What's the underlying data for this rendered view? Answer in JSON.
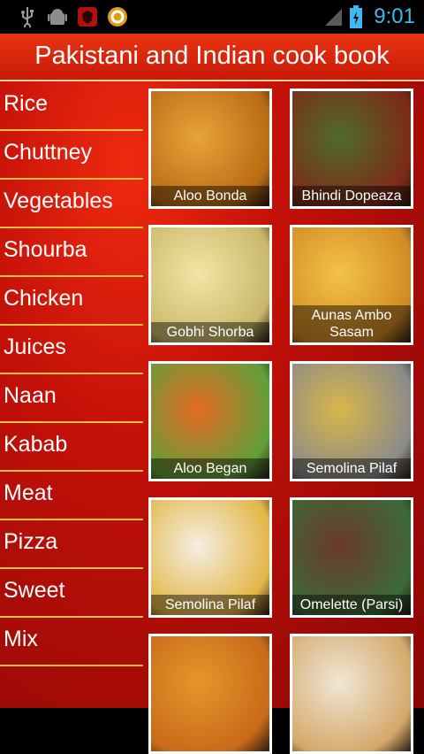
{
  "status_bar": {
    "icons": [
      "usb-icon",
      "android-debug-icon",
      "shield-icon",
      "sync-icon"
    ],
    "time": "9:01"
  },
  "header": {
    "title": "Pakistani and Indian cook book"
  },
  "sidebar": {
    "items": [
      {
        "label": "Rice"
      },
      {
        "label": "Chuttney"
      },
      {
        "label": "Vegetables"
      },
      {
        "label": "Shourba"
      },
      {
        "label": "Chicken"
      },
      {
        "label": "Juices"
      },
      {
        "label": "Naan"
      },
      {
        "label": "Kabab"
      },
      {
        "label": "Meat"
      },
      {
        "label": "Pizza"
      },
      {
        "label": "Sweet"
      },
      {
        "label": "Mix"
      }
    ]
  },
  "recipes": [
    {
      "title": "Aloo Bonda",
      "color1": "#e8a33a",
      "color2": "#b86a14"
    },
    {
      "title": "Bhindi Dopeaza",
      "color1": "#4f6b2a",
      "color2": "#7e2a18"
    },
    {
      "title": "Gobhi Shorba",
      "color1": "#f2e6a6",
      "color2": "#c9b86a"
    },
    {
      "title": "Aunas Ambo Sasam",
      "color1": "#f3c248",
      "color2": "#d18a24"
    },
    {
      "title": "Aloo Began",
      "color1": "#e46a22",
      "color2": "#5fa03a"
    },
    {
      "title": "Semolina Pilaf",
      "color1": "#d9b64a",
      "color2": "#8a8a8a"
    },
    {
      "title": "Semolina Pilaf",
      "color1": "#f4efe2",
      "color2": "#e3b545"
    },
    {
      "title": "Omelette (Parsi)",
      "color1": "#6a3a2a",
      "color2": "#3c6a3a"
    },
    {
      "title": "",
      "color1": "#e6962a",
      "color2": "#c86a1a"
    },
    {
      "title": "",
      "color1": "#f1e6d6",
      "color2": "#d4a86a"
    }
  ]
}
